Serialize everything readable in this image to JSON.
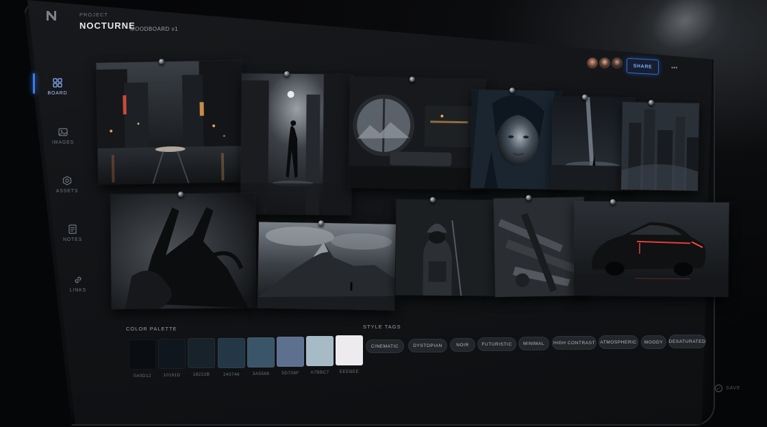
{
  "header": {
    "logo_icon": "n-logo-icon",
    "project_label": "PROJECT",
    "project_title": "NOCTURNE",
    "project_subtitle": "MOODBOARD v1",
    "share_label": "SHARE",
    "more_icon": "ellipsis-icon"
  },
  "sidebar": {
    "items": [
      {
        "label": "BOARD",
        "icon": "grid-icon",
        "active": true
      },
      {
        "label": "IMAGES",
        "icon": "image-icon",
        "active": false
      },
      {
        "label": "ASSETS",
        "icon": "hexagon-icon",
        "active": false
      },
      {
        "label": "NOTES",
        "icon": "notes-icon",
        "active": false
      },
      {
        "label": "LINKS",
        "icon": "link-icon",
        "active": false
      }
    ]
  },
  "palette": {
    "label": "COLOR PALETTE",
    "swatches": [
      {
        "code": "0A0D12",
        "color": "#0A0D12"
      },
      {
        "code": "10161D",
        "color": "#10161D"
      },
      {
        "code": "18222B",
        "color": "#18222B"
      },
      {
        "code": "243746",
        "color": "#243746"
      },
      {
        "code": "3A5568",
        "color": "#3A5568"
      },
      {
        "code": "5D708F",
        "color": "#5D708F"
      },
      {
        "code": "A7BBC7",
        "color": "#A7BBC7"
      },
      {
        "code": "EEEBEE",
        "color": "#EEEBEE"
      }
    ]
  },
  "style_tags": {
    "label": "STYLE TAGS",
    "tags": [
      "CINEMATIC",
      "DYSTOPIAN",
      "NOIR",
      "FUTURISTIC",
      "MINIMAL",
      "HIGH CONTRAST",
      "ATMOSPHERIC",
      "MOODY",
      "DESATURATED"
    ]
  },
  "save_label": "SAVE",
  "accent_color": "#3A7BF0"
}
